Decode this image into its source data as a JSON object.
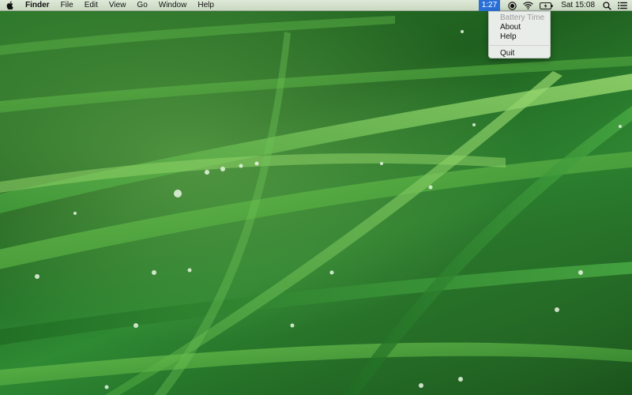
{
  "menubar": {
    "app_name": "Finder",
    "items": [
      "File",
      "Edit",
      "View",
      "Go",
      "Window",
      "Help"
    ],
    "icons": [
      "apple-icon",
      "record-icon",
      "wifi-icon",
      "battery-icon",
      "spotlight-search-icon",
      "notification-center-icon"
    ]
  },
  "status": {
    "battery_time": "1:27",
    "clock": "Sat 15:08",
    "accent_color": "#2a6fd6"
  },
  "dropdown": {
    "header": "Battery Time",
    "items": [
      "About",
      "Help"
    ],
    "quit": "Quit"
  }
}
